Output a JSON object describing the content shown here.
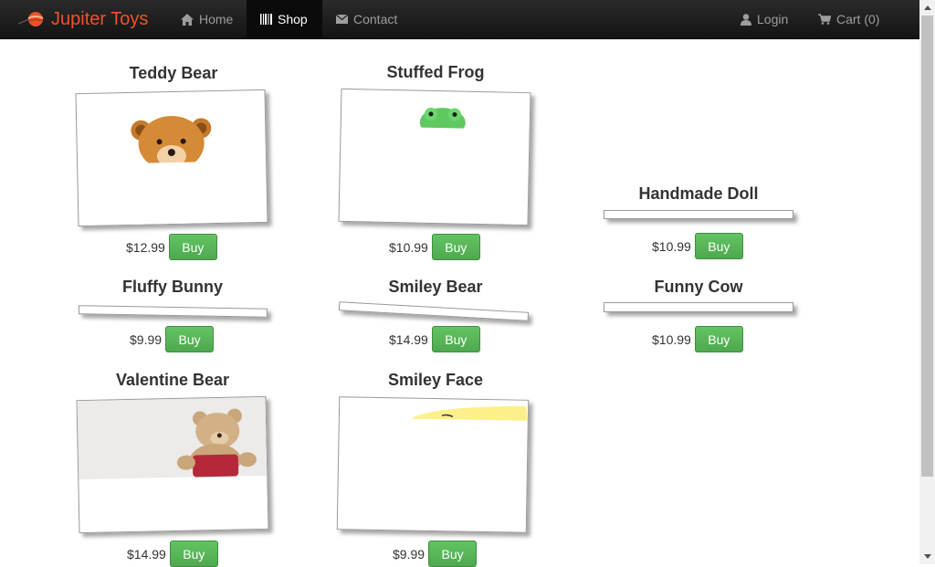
{
  "brand": {
    "name": "Jupiter Toys",
    "color": "#f0522b"
  },
  "nav": {
    "home": "Home",
    "shop": "Shop",
    "contact": "Contact",
    "login": "Login",
    "cart": "Cart (0)"
  },
  "buy_label": "Buy",
  "products": [
    {
      "title": "Teddy Bear",
      "price": "$12.99"
    },
    {
      "title": "Stuffed Frog",
      "price": "$10.99"
    },
    {
      "title": "Handmade Doll",
      "price": "$10.99"
    },
    {
      "title": "Fluffy Bunny",
      "price": "$9.99"
    },
    {
      "title": "Smiley Bear",
      "price": "$14.99"
    },
    {
      "title": "Funny Cow",
      "price": "$10.99"
    },
    {
      "title": "Valentine Bear",
      "price": "$14.99"
    },
    {
      "title": "Smiley Face",
      "price": "$9.99"
    }
  ]
}
